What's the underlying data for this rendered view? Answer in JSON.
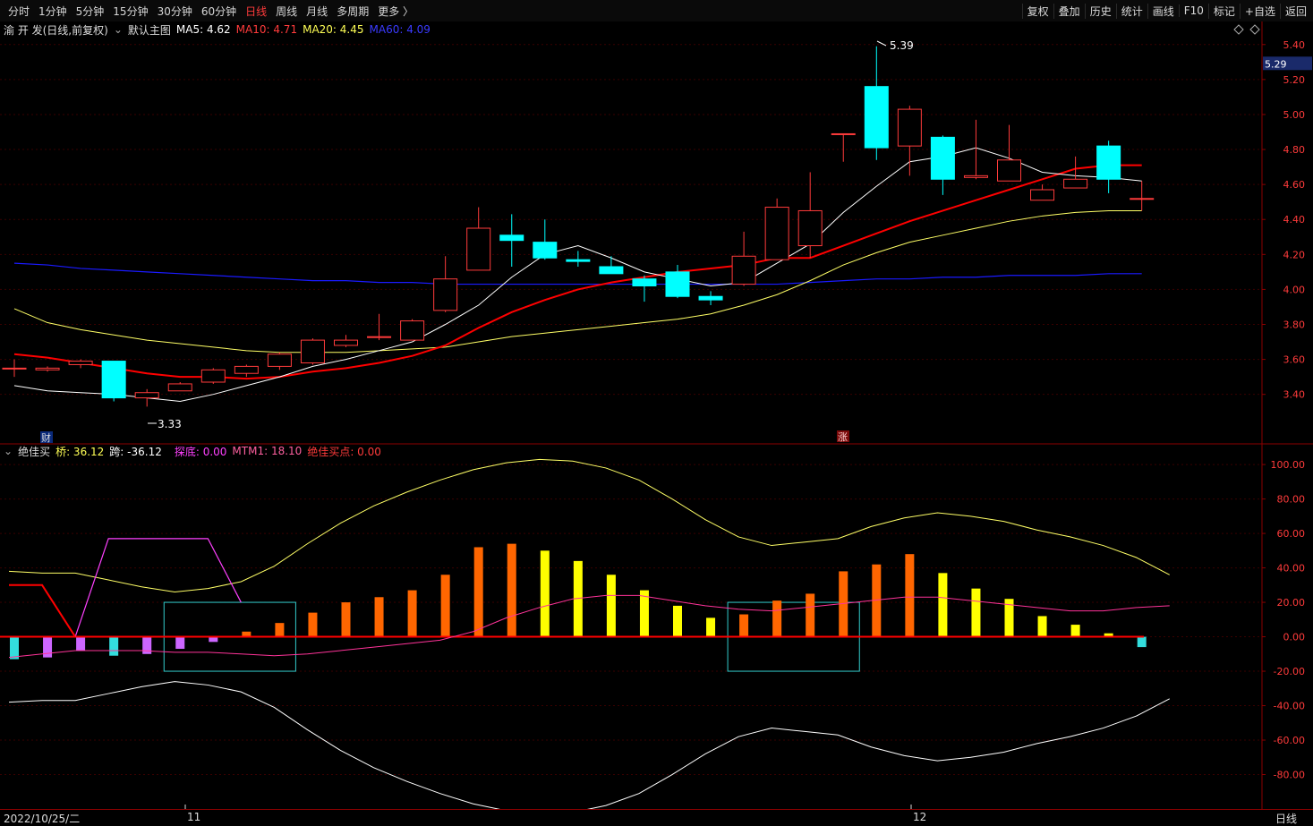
{
  "toolbar": {
    "periods": [
      "分时",
      "1分钟",
      "5分钟",
      "15分钟",
      "30分钟",
      "60分钟",
      "日线",
      "周线",
      "月线",
      "多周期",
      "更多 〉"
    ],
    "active_period": "日线",
    "right": [
      "复权",
      "叠加",
      "历史",
      "统计",
      "画线",
      "F10",
      "标记",
      "+自选",
      "返回"
    ]
  },
  "main_header": {
    "stock": "渝 开 发(日线,前复权)",
    "template": "默认主图",
    "ma5": "MA5: 4.62",
    "ma10": "MA10: 4.71",
    "ma20": "MA20: 4.45",
    "ma60": "MA60: 4.09"
  },
  "indicator_header": {
    "name": "绝佳买",
    "bridge": "桥: 36.12",
    "span": "跨: -36.12",
    "bottom": "探底: 0.00",
    "mtm1": "MTM1: 18.10",
    "buy": "绝佳买点: 0.00"
  },
  "bottom": {
    "date": "2022/10/25/二",
    "month_marks": [
      "11",
      "12"
    ],
    "axis_tab": "日线"
  },
  "markers": {
    "finance": "财",
    "rise": "涨",
    "high": "5.39",
    "low": "3.33",
    "current_price": "5.29"
  },
  "colors": {
    "up": "#ff3b3b",
    "down": "#00ffff",
    "ma5": "#ffffff",
    "ma10": "#ff0000",
    "ma20": "#ffff66",
    "ma60": "#1a1aff"
  },
  "chart_data": [
    {
      "type": "candlestick",
      "ylim": [
        3.25,
        5.45
      ],
      "yticks": [
        3.4,
        3.6,
        3.8,
        4.0,
        4.2,
        4.4,
        4.6,
        4.8,
        5.0,
        5.2,
        5.4
      ],
      "candles": [
        {
          "o": 3.55,
          "h": 3.6,
          "l": 3.5,
          "c": 3.55
        },
        {
          "o": 3.54,
          "h": 3.56,
          "l": 3.53,
          "c": 3.55
        },
        {
          "o": 3.57,
          "h": 3.6,
          "l": 3.55,
          "c": 3.59
        },
        {
          "o": 3.59,
          "h": 3.59,
          "l": 3.36,
          "c": 3.38
        },
        {
          "o": 3.38,
          "h": 3.43,
          "l": 3.33,
          "c": 3.41
        },
        {
          "o": 3.42,
          "h": 3.47,
          "l": 3.42,
          "c": 3.46
        },
        {
          "o": 3.47,
          "h": 3.55,
          "l": 3.46,
          "c": 3.54
        },
        {
          "o": 3.52,
          "h": 3.57,
          "l": 3.5,
          "c": 3.56
        },
        {
          "o": 3.56,
          "h": 3.64,
          "l": 3.54,
          "c": 3.63
        },
        {
          "o": 3.58,
          "h": 3.72,
          "l": 3.57,
          "c": 3.71
        },
        {
          "o": 3.68,
          "h": 3.74,
          "l": 3.67,
          "c": 3.71
        },
        {
          "o": 3.73,
          "h": 3.86,
          "l": 3.71,
          "c": 3.73
        },
        {
          "o": 3.71,
          "h": 3.83,
          "l": 3.71,
          "c": 3.82
        },
        {
          "o": 3.88,
          "h": 4.19,
          "l": 3.87,
          "c": 4.06
        },
        {
          "o": 4.11,
          "h": 4.47,
          "l": 4.11,
          "c": 4.35
        },
        {
          "o": 4.31,
          "h": 4.43,
          "l": 4.13,
          "c": 4.28
        },
        {
          "o": 4.27,
          "h": 4.4,
          "l": 4.17,
          "c": 4.18
        },
        {
          "o": 4.17,
          "h": 4.22,
          "l": 4.13,
          "c": 4.16
        },
        {
          "o": 4.13,
          "h": 4.19,
          "l": 4.09,
          "c": 4.09
        },
        {
          "o": 4.06,
          "h": 4.08,
          "l": 3.93,
          "c": 4.02
        },
        {
          "o": 4.1,
          "h": 4.14,
          "l": 3.95,
          "c": 3.96
        },
        {
          "o": 3.96,
          "h": 3.99,
          "l": 3.91,
          "c": 3.94
        },
        {
          "o": 4.03,
          "h": 4.33,
          "l": 4.02,
          "c": 4.19
        },
        {
          "o": 4.17,
          "h": 4.52,
          "l": 4.17,
          "c": 4.47
        },
        {
          "o": 4.25,
          "h": 4.67,
          "l": 4.18,
          "c": 4.45
        },
        {
          "o": 4.89,
          "h": 4.89,
          "l": 4.73,
          "c": 4.89
        },
        {
          "o": 5.16,
          "h": 5.39,
          "l": 4.74,
          "c": 4.81
        },
        {
          "o": 4.82,
          "h": 5.05,
          "l": 4.65,
          "c": 5.03
        },
        {
          "o": 4.87,
          "h": 4.88,
          "l": 4.54,
          "c": 4.63
        },
        {
          "o": 4.64,
          "h": 4.97,
          "l": 4.63,
          "c": 4.65
        },
        {
          "o": 4.62,
          "h": 4.94,
          "l": 4.62,
          "c": 4.74
        },
        {
          "o": 4.51,
          "h": 4.6,
          "l": 4.51,
          "c": 4.57
        },
        {
          "o": 4.58,
          "h": 4.76,
          "l": 4.58,
          "c": 4.63
        },
        {
          "o": 4.82,
          "h": 4.85,
          "l": 4.55,
          "c": 4.63
        },
        {
          "o": 4.52,
          "h": 4.62,
          "l": 4.45,
          "c": 4.52
        }
      ],
      "ma5": [
        3.45,
        3.42,
        3.41,
        3.4,
        3.38,
        3.36,
        3.4,
        3.45,
        3.5,
        3.56,
        3.6,
        3.65,
        3.7,
        3.8,
        3.91,
        4.07,
        4.2,
        4.25,
        4.18,
        4.1,
        4.06,
        4.02,
        4.04,
        4.15,
        4.26,
        4.44,
        4.59,
        4.73,
        4.76,
        4.81,
        4.75,
        4.67,
        4.65,
        4.64,
        4.62
      ],
      "ma10": [
        3.63,
        3.61,
        3.58,
        3.55,
        3.52,
        3.5,
        3.5,
        3.49,
        3.5,
        3.53,
        3.55,
        3.58,
        3.62,
        3.68,
        3.78,
        3.87,
        3.94,
        4.0,
        4.04,
        4.07,
        4.1,
        4.12,
        4.14,
        4.18,
        4.18,
        4.25,
        4.32,
        4.39,
        4.45,
        4.51,
        4.57,
        4.63,
        4.69,
        4.71,
        4.71
      ],
      "ma20": [
        3.89,
        3.81,
        3.77,
        3.74,
        3.71,
        3.69,
        3.67,
        3.65,
        3.64,
        3.64,
        3.64,
        3.65,
        3.66,
        3.67,
        3.7,
        3.73,
        3.75,
        3.77,
        3.79,
        3.81,
        3.83,
        3.86,
        3.91,
        3.97,
        4.05,
        4.14,
        4.21,
        4.27,
        4.31,
        4.35,
        4.39,
        4.42,
        4.44,
        4.45,
        4.45
      ],
      "ma60": [
        4.15,
        4.14,
        4.12,
        4.11,
        4.1,
        4.09,
        4.08,
        4.07,
        4.06,
        4.05,
        4.05,
        4.04,
        4.04,
        4.03,
        4.03,
        4.03,
        4.03,
        4.03,
        4.03,
        4.03,
        4.03,
        4.03,
        4.03,
        4.03,
        4.04,
        4.05,
        4.06,
        4.06,
        4.07,
        4.07,
        4.08,
        4.08,
        4.08,
        4.09,
        4.09
      ]
    },
    {
      "type": "bar",
      "ylim": [
        -100,
        112
      ],
      "yticks": [
        100,
        80,
        60,
        40,
        20,
        0,
        -20,
        -40,
        -60,
        -80
      ],
      "values": [
        -13,
        -12,
        -8,
        -11,
        -10,
        -7,
        -3,
        3,
        8,
        14,
        20,
        23,
        27,
        36,
        52,
        54,
        50,
        44,
        36,
        27,
        18,
        11,
        13,
        21,
        25,
        38,
        42,
        48,
        37,
        28,
        22,
        12,
        7,
        2,
        -6
      ],
      "bar_colors": [
        "c",
        "m",
        "m",
        "c",
        "m",
        "m",
        "m",
        "o",
        "o",
        "o",
        "o",
        "o",
        "o",
        "o",
        "o",
        "o",
        "y",
        "y",
        "y",
        "y",
        "y",
        "y",
        "o",
        "o",
        "o",
        "o",
        "o",
        "o",
        "y",
        "y",
        "y",
        "y",
        "y",
        "y",
        "c"
      ],
      "bridge": [
        38,
        37,
        37,
        33,
        29,
        26,
        28,
        32,
        41,
        54,
        66,
        76,
        84,
        91,
        97,
        101,
        103,
        102,
        98,
        91,
        80,
        68,
        58,
        53,
        55,
        57,
        64,
        69,
        72,
        70,
        67,
        62,
        58,
        53,
        46,
        36
      ],
      "span": [
        -38,
        -37,
        -37,
        -33,
        -29,
        -26,
        -28,
        -32,
        -41,
        -54,
        -66,
        -76,
        -84,
        -91,
        -97,
        -101,
        -103,
        -102,
        -98,
        -91,
        -80,
        -68,
        -58,
        -53,
        -55,
        -57,
        -64,
        -69,
        -72,
        -70,
        -67,
        -62,
        -58,
        -53,
        -46,
        -36
      ],
      "mtm1": [
        -12,
        -10,
        -8,
        -8,
        -8,
        -9,
        -9,
        -10,
        -11,
        -10,
        -8,
        -6,
        -4,
        -2,
        3,
        11,
        17,
        22,
        24,
        24,
        21,
        18,
        16,
        15,
        17,
        19,
        21,
        23,
        23,
        21,
        19,
        17,
        15,
        15,
        17,
        18
      ],
      "bottom": [
        null,
        null,
        0,
        57,
        57,
        57,
        57,
        20
      ],
      "mtm_red": [
        30,
        30,
        0
      ],
      "boxes": [
        [
          5,
          8,
          -20,
          20
        ],
        [
          22,
          25,
          -20,
          20
        ]
      ]
    }
  ]
}
